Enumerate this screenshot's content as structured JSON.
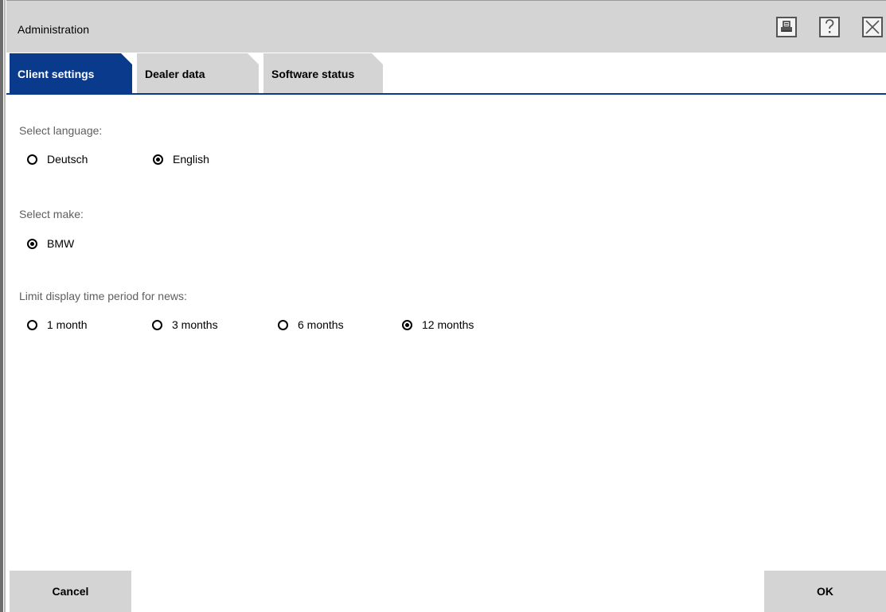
{
  "window": {
    "title": "Administration",
    "icons": {
      "print": "printer-icon",
      "help": "help-icon",
      "close": "close-icon"
    }
  },
  "tabs": [
    {
      "label": "Client settings",
      "active": true
    },
    {
      "label": "Dealer data",
      "active": false
    },
    {
      "label": "Software status",
      "active": false
    }
  ],
  "language": {
    "label": "Select language:",
    "options": [
      {
        "label": "Deutsch",
        "checked": false
      },
      {
        "label": "English",
        "checked": true
      }
    ]
  },
  "make": {
    "label": "Select make:",
    "options": [
      {
        "label": "BMW",
        "checked": true
      }
    ]
  },
  "news_period": {
    "label": "Limit display time period for news:",
    "options": [
      {
        "label": "1 month",
        "checked": false
      },
      {
        "label": "3 months",
        "checked": false
      },
      {
        "label": "6 months",
        "checked": false
      },
      {
        "label": "12 months",
        "checked": true
      }
    ]
  },
  "footer": {
    "cancel_label": "Cancel",
    "ok_label": "OK"
  },
  "colors": {
    "accent": "#0a3a8c",
    "panel": "#d4d4d4",
    "muted_text": "#5e5e5e"
  }
}
